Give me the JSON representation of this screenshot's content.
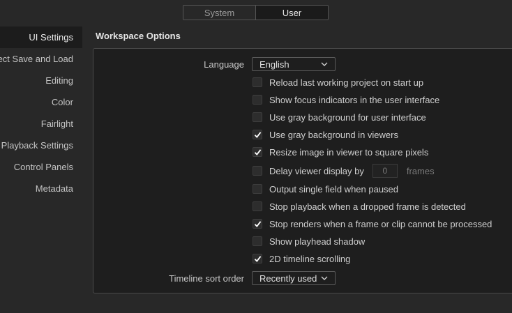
{
  "tabs": [
    {
      "label": "System",
      "active": false
    },
    {
      "label": "User",
      "active": true
    }
  ],
  "sidebar": {
    "items": [
      {
        "label": "UI Settings",
        "active": true
      },
      {
        "label": "Project Save and Load",
        "active": false
      },
      {
        "label": "Editing",
        "active": false
      },
      {
        "label": "Color",
        "active": false
      },
      {
        "label": "Fairlight",
        "active": false
      },
      {
        "label": "Playback Settings",
        "active": false
      },
      {
        "label": "Control Panels",
        "active": false
      },
      {
        "label": "Metadata",
        "active": false
      }
    ]
  },
  "main": {
    "section_title": "Workspace Options",
    "language": {
      "label": "Language",
      "value": "English"
    },
    "options": [
      {
        "label": "Reload last working project on start up",
        "checked": false
      },
      {
        "label": "Show focus indicators in the user interface",
        "checked": false
      },
      {
        "label": "Use gray background for user interface",
        "checked": false
      },
      {
        "label": "Use gray background in viewers",
        "checked": true
      },
      {
        "label": "Resize image in viewer to square pixels",
        "checked": true
      },
      {
        "label": "Delay viewer display by",
        "checked": false
      },
      {
        "label": "Output single field when paused",
        "checked": false
      },
      {
        "label": "Stop playback when a dropped frame is detected",
        "checked": false
      },
      {
        "label": "Stop renders when a frame or clip cannot be processed",
        "checked": true
      },
      {
        "label": "Show playhead shadow",
        "checked": false
      },
      {
        "label": "2D timeline scrolling",
        "checked": true
      }
    ],
    "delay": {
      "value": "0",
      "unit": "frames"
    },
    "timeline_sort": {
      "label": "Timeline sort order",
      "value": "Recently used"
    }
  },
  "colors": {
    "background": "#282828",
    "panel": "#1e1e1e",
    "checkbox": "#2d2d2d",
    "checkmark": "#ffffff"
  }
}
